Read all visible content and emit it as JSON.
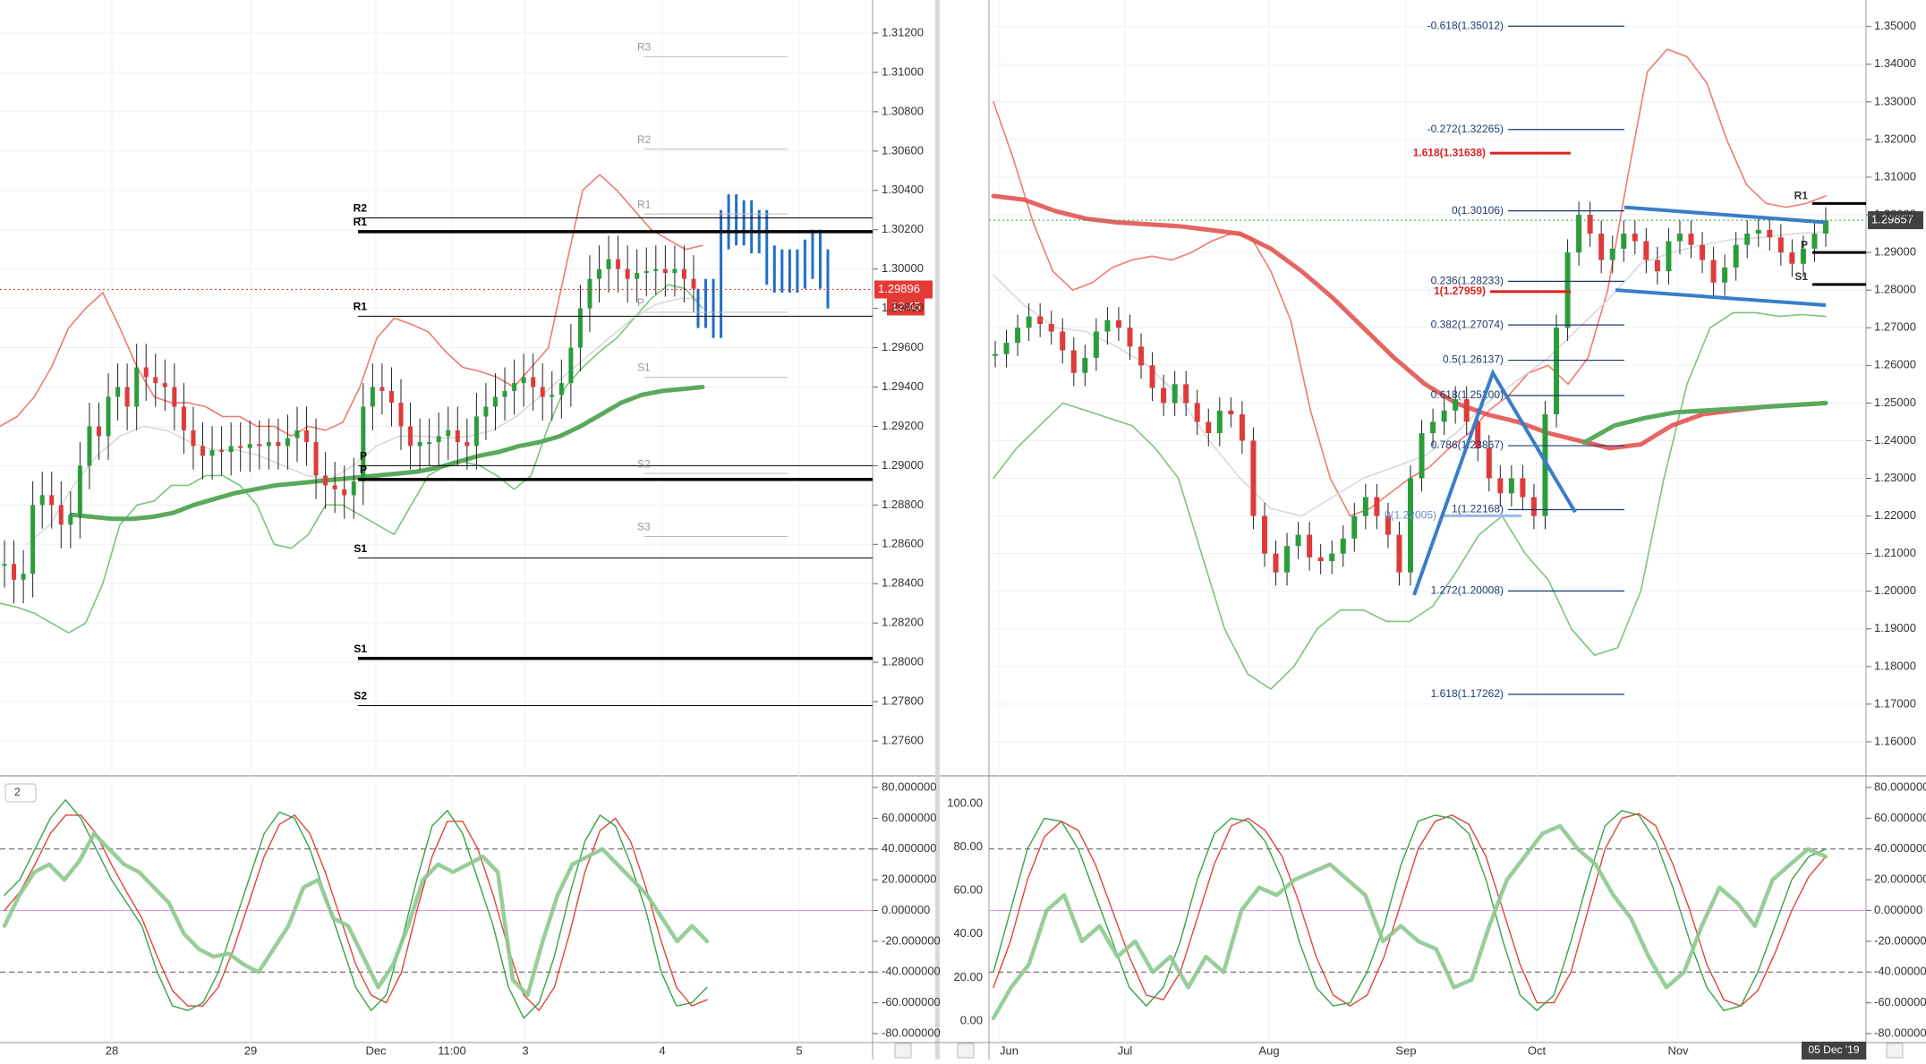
{
  "chart_data": [
    {
      "type": "line",
      "panel": "left-price",
      "y_ticks": [
        "1.31200",
        "1.31000",
        "1.30800",
        "1.30600",
        "1.30400",
        "1.30200",
        "1.30000",
        "1.29800",
        "1.29600",
        "1.29400",
        "1.29200",
        "1.29000",
        "1.28800",
        "1.28600",
        "1.28400",
        "1.28200",
        "1.28000",
        "1.27800",
        "1.27600"
      ],
      "ylim": [
        1.275,
        1.313
      ],
      "x_ticks": [
        "28",
        "29",
        "Dec",
        "11:00",
        "3",
        "4",
        "5"
      ],
      "price_label": "1.29896",
      "countdown_label": "12:45",
      "last_price": 1.29896,
      "pivot_levels": [
        {
          "label": "R3",
          "value": 1.3108,
          "style": "faint"
        },
        {
          "label": "R2",
          "value": 1.3061,
          "style": "faint"
        },
        {
          "label": "R1",
          "value": 1.3028,
          "style": "faint"
        },
        {
          "label": "R2",
          "value": 1.3026,
          "style": "thin"
        },
        {
          "label": "R1",
          "value": 1.3019,
          "style": "thick"
        },
        {
          "label": "P",
          "value": 1.2978,
          "style": "faint"
        },
        {
          "label": "R1",
          "value": 1.2976,
          "style": "thin"
        },
        {
          "label": "S1",
          "value": 1.2945,
          "style": "faint"
        },
        {
          "label": "P",
          "value": 1.29,
          "style": "thin"
        },
        {
          "label": "S2",
          "value": 1.2896,
          "style": "faint"
        },
        {
          "label": "P",
          "value": 1.2893,
          "style": "thick"
        },
        {
          "label": "S3",
          "value": 1.2864,
          "style": "faint"
        },
        {
          "label": "S1",
          "value": 1.2853,
          "style": "thin"
        },
        {
          "label": "S1",
          "value": 1.2802,
          "style": "thick"
        },
        {
          "label": "S2",
          "value": 1.2778,
          "style": "thin"
        }
      ],
      "close": [
        1.285,
        1.2842,
        1.2845,
        1.288,
        1.2885,
        1.288,
        1.287,
        1.2875,
        1.29,
        1.292,
        1.2915,
        1.2935,
        1.294,
        1.293,
        1.295,
        1.2945,
        1.2942,
        1.294,
        1.293,
        1.2918,
        1.291,
        1.2905,
        1.2908,
        1.2907,
        1.291,
        1.2909,
        1.2911,
        1.291,
        1.2912,
        1.291,
        1.2914,
        1.2918,
        1.2912,
        1.2895,
        1.289,
        1.2888,
        1.2885,
        1.2892,
        1.293,
        1.294,
        1.2938,
        1.2932,
        1.292,
        1.291,
        1.2912,
        1.2912,
        1.2915,
        1.2918,
        1.2912,
        1.291,
        1.2925,
        1.293,
        1.2935,
        1.2938,
        1.2942,
        1.2945,
        1.294,
        1.2935,
        1.2936,
        1.2942,
        1.296,
        1.298,
        1.2995,
        1.3,
        1.3005,
        1.3,
        1.2995,
        1.2998,
        1.2999,
        1.3,
        1.2998,
        1.3,
        1.2995,
        1.299
      ],
      "forecast_close": [
        1.298,
        1.2985,
        1.2975,
        1.302,
        1.3028,
        1.3022,
        1.3025,
        1.3018,
        1.302,
        1.3002,
        1.2998,
        1.3,
        1.2998,
        1.3,
        1.3005,
        1.301,
        1.3,
        1.299
      ],
      "bb_upper": [
        1.292,
        1.2925,
        1.2935,
        1.295,
        1.297,
        1.298,
        1.2988,
        1.297,
        1.295,
        1.2935,
        1.2932,
        1.2932,
        1.293,
        1.2925,
        1.2925,
        1.292,
        1.292,
        1.2915,
        1.292,
        1.2918,
        1.2922,
        1.294,
        1.2965,
        1.2975,
        1.2972,
        1.2968,
        1.2958,
        1.295,
        1.2948,
        1.2945,
        1.294,
        1.295,
        1.296,
        1.3,
        1.304,
        1.3048,
        1.304,
        1.303,
        1.302,
        1.3015,
        1.301,
        1.3012
      ],
      "bb_lower": [
        1.283,
        1.2828,
        1.2825,
        1.282,
        1.2815,
        1.282,
        1.284,
        1.287,
        1.288,
        1.2882,
        1.289,
        1.289,
        1.2895,
        1.2895,
        1.289,
        1.288,
        1.286,
        1.2858,
        1.2865,
        1.288,
        1.288,
        1.2875,
        1.287,
        1.2865,
        1.288,
        1.2895,
        1.29,
        1.2902,
        1.29,
        1.2895,
        1.2888,
        1.2895,
        1.292,
        1.294,
        1.295,
        1.2958,
        1.2965,
        1.2975,
        1.2985,
        1.2992,
        1.299,
        1.298
      ],
      "ma_slow": [
        1.2875,
        1.2874,
        1.2873,
        1.2873,
        1.2874,
        1.2876,
        1.288,
        1.2883,
        1.2886,
        1.2888,
        1.289,
        1.2891,
        1.2892,
        1.2893,
        1.2894,
        1.2895,
        1.2896,
        1.2897,
        1.2899,
        1.2902,
        1.2905,
        1.2907,
        1.291,
        1.2912,
        1.2915,
        1.292,
        1.2926,
        1.2932,
        1.2936,
        1.2938,
        1.2939,
        1.294
      ],
      "ma_mid": [
        1.286,
        1.287,
        1.289,
        1.2905,
        1.2915,
        1.292,
        1.2918,
        1.2912,
        1.2908,
        1.2908,
        1.2905,
        1.29,
        1.2895,
        1.2893,
        1.29,
        1.291,
        1.2915,
        1.2915,
        1.2914,
        1.2915,
        1.2918,
        1.2925,
        1.2935,
        1.2945,
        1.2955,
        1.2965,
        1.2975,
        1.2982,
        1.2985,
        1.2985
      ]
    },
    {
      "type": "line",
      "panel": "left-oscillator",
      "indicator_label": "2",
      "y_ticks": [
        "80.000000",
        "60.000000",
        "40.000000",
        "20.000000",
        "0.000000",
        "-20.000000",
        "-40.000000",
        "-60.000000",
        "-80.000000"
      ],
      "ylim": [
        -80,
        80
      ],
      "levels": [
        40,
        0,
        -40
      ],
      "fast": [
        10,
        20,
        40,
        60,
        72,
        60,
        40,
        20,
        5,
        -10,
        -40,
        -62,
        -65,
        -60,
        -40,
        -10,
        20,
        50,
        64,
        60,
        40,
        10,
        -20,
        -50,
        -65,
        -55,
        -20,
        20,
        55,
        65,
        50,
        20,
        -10,
        -50,
        -70,
        -60,
        -30,
        10,
        45,
        62,
        55,
        30,
        0,
        -40,
        -62,
        -60,
        -50
      ],
      "slow": [
        0,
        12,
        30,
        50,
        62,
        62,
        50,
        30,
        12,
        -5,
        -30,
        -52,
        -62,
        -62,
        -50,
        -25,
        5,
        35,
        56,
        62,
        50,
        25,
        -5,
        -35,
        -55,
        -60,
        -40,
        0,
        35,
        58,
        58,
        40,
        10,
        -25,
        -55,
        -65,
        -50,
        -15,
        25,
        52,
        60,
        45,
        15,
        -20,
        -50,
        -62,
        -58
      ],
      "thick": [
        -10,
        10,
        25,
        30,
        20,
        32,
        50,
        40,
        30,
        25,
        15,
        5,
        -15,
        -25,
        -30,
        -28,
        -35,
        -40,
        -25,
        -10,
        15,
        20,
        -5,
        -10,
        -30,
        -50,
        -35,
        -10,
        20,
        30,
        25,
        30,
        35,
        25,
        -45,
        -55,
        -20,
        10,
        30,
        35,
        40,
        30,
        20,
        10,
        -5,
        -20,
        -10,
        -20
      ]
    },
    {
      "type": "line",
      "panel": "right-price",
      "y_ticks": [
        "1.35000",
        "1.34000",
        "1.33000",
        "1.32000",
        "1.31000",
        "1.30000",
        "1.29000",
        "1.28000",
        "1.27000",
        "1.26000",
        "1.25000",
        "1.24000",
        "1.23000",
        "1.22000",
        "1.21000",
        "1.20000",
        "1.19000",
        "1.18000",
        "1.17000",
        "1.16000"
      ],
      "ylim": [
        1.155,
        1.3535
      ],
      "x_ticks": [
        "Jun",
        "Jul",
        "Aug",
        "Sep",
        "Oct",
        "Nov"
      ],
      "date_label": "05 Dec '19",
      "price_label": "1.29857",
      "last_price": 1.29857,
      "fibonacci": [
        {
          "label": "-0.618(1.35012)",
          "value": 1.35012
        },
        {
          "label": "-0.272(1.32265)",
          "value": 1.32265
        },
        {
          "label": "0(1.30106)",
          "value": 1.30106
        },
        {
          "label": "0.236(1.28233)",
          "value": 1.28233
        },
        {
          "label": "0.382(1.27074)",
          "value": 1.27074
        },
        {
          "label": "0.5(1.26137)",
          "value": 1.26137
        },
        {
          "label": "0.618(1.25200)",
          "value": 1.252
        },
        {
          "label": "0.786(1.23867)",
          "value": 1.23867
        },
        {
          "label": "1(1.22168)",
          "value": 1.22168
        },
        {
          "label": "1.272(1.20008)",
          "value": 1.20008
        },
        {
          "label": "1.618(1.17262)",
          "value": 1.17262
        }
      ],
      "red_levels": [
        {
          "label": "1.618(1.31638)",
          "value": 1.31638
        },
        {
          "label": "1(1.27959)",
          "value": 1.27959
        }
      ],
      "abc_label": "0(1.22005)",
      "abc_value": 1.22005,
      "pivot_levels": [
        {
          "label": "R1",
          "value": 1.303
        },
        {
          "label": "P",
          "value": 1.29
        },
        {
          "label": "S1",
          "value": 1.2815
        }
      ],
      "close": [
        1.263,
        1.266,
        1.27,
        1.273,
        1.271,
        1.269,
        1.264,
        1.258,
        1.262,
        1.269,
        1.272,
        1.27,
        1.265,
        1.26,
        1.254,
        1.25,
        1.255,
        1.25,
        1.245,
        1.242,
        1.248,
        1.247,
        1.24,
        1.22,
        1.21,
        1.205,
        1.212,
        1.215,
        1.209,
        1.208,
        1.21,
        1.214,
        1.22,
        1.225,
        1.22,
        1.215,
        1.205,
        1.23,
        1.242,
        1.245,
        1.248,
        1.251,
        1.245,
        1.238,
        1.23,
        1.226,
        1.23,
        1.225,
        1.22,
        1.247,
        1.27,
        1.29,
        1.3,
        1.295,
        1.288,
        1.291,
        1.295,
        1.293,
        1.288,
        1.285,
        1.293,
        1.295,
        1.292,
        1.288,
        1.282,
        1.286,
        1.292,
        1.295,
        1.296,
        1.294,
        1.29,
        1.287,
        1.291,
        1.295,
        1.2985
      ],
      "bb_upper": [
        1.33,
        1.315,
        1.298,
        1.285,
        1.28,
        1.282,
        1.286,
        1.288,
        1.289,
        1.288,
        1.29,
        1.293,
        1.295,
        1.294,
        1.285,
        1.272,
        1.248,
        1.23,
        1.22,
        1.222,
        1.226,
        1.23,
        1.233,
        1.238,
        1.242,
        1.248,
        1.252,
        1.258,
        1.26,
        1.255,
        1.262,
        1.28,
        1.31,
        1.338,
        1.344,
        1.342,
        1.335,
        1.32,
        1.308,
        1.303,
        1.302,
        1.303,
        1.305
      ],
      "bb_lower": [
        1.23,
        1.238,
        1.244,
        1.25,
        1.248,
        1.246,
        1.244,
        1.238,
        1.23,
        1.21,
        1.19,
        1.178,
        1.174,
        1.18,
        1.19,
        1.195,
        1.195,
        1.192,
        1.192,
        1.196,
        1.205,
        1.215,
        1.22,
        1.21,
        1.203,
        1.19,
        1.183,
        1.185,
        1.2,
        1.23,
        1.255,
        1.27,
        1.274,
        1.274,
        1.273,
        1.2735,
        1.273
      ],
      "ma_slow": [
        1.305,
        1.304,
        1.301,
        1.299,
        1.298,
        1.2975,
        1.297,
        1.296,
        1.295,
        1.291,
        1.285,
        1.278,
        1.27,
        1.262,
        1.255,
        1.25,
        1.247,
        1.245,
        1.242,
        1.24,
        1.238,
        1.239,
        1.244,
        1.247,
        1.248,
        1.249,
        1.2495,
        1.25
      ],
      "ma_mid": [
        1.284,
        1.276,
        1.27,
        1.269,
        1.265,
        1.26,
        1.252,
        1.24,
        1.23,
        1.222,
        1.22,
        1.225,
        1.23,
        1.233,
        1.236,
        1.242,
        1.25,
        1.256,
        1.262,
        1.27,
        1.278,
        1.287,
        1.29,
        1.292,
        1.2935,
        1.294,
        1.295,
        1.2955
      ],
      "wedge_top": [
        1.302,
        1.298
      ],
      "wedge_bottom": [
        1.28,
        1.276
      ],
      "zigzag": [
        1.199,
        1.258,
        1.221
      ]
    },
    {
      "type": "line",
      "panel": "right-oscillator",
      "left_y_ticks": [
        "100.00",
        "80.00",
        "60.00",
        "40.00",
        "20.00",
        "0.00"
      ],
      "right_y_ticks": [
        "80.000000",
        "60.000000",
        "40.000000",
        "20.000000",
        "0.000000",
        "-20.000000",
        "-40.000000",
        "-60.000000",
        "-80.000000"
      ],
      "ylim": [
        -80,
        80
      ],
      "levels": [
        40,
        0,
        -40
      ],
      "fast": [
        -40,
        0,
        40,
        60,
        58,
        40,
        10,
        -20,
        -50,
        -62,
        -50,
        -20,
        20,
        50,
        60,
        58,
        45,
        20,
        -20,
        -50,
        -62,
        -60,
        -40,
        -10,
        30,
        58,
        62,
        60,
        50,
        20,
        -20,
        -55,
        -65,
        -55,
        -20,
        20,
        55,
        65,
        62,
        45,
        15,
        -20,
        -50,
        -65,
        -62,
        -40,
        -10,
        20,
        35,
        40
      ],
      "slow": [
        -50,
        -20,
        20,
        48,
        58,
        52,
        30,
        0,
        -30,
        -55,
        -58,
        -40,
        -5,
        30,
        55,
        60,
        52,
        35,
        5,
        -30,
        -55,
        -62,
        -55,
        -30,
        5,
        40,
        58,
        62,
        56,
        35,
        0,
        -35,
        -60,
        -60,
        -40,
        0,
        40,
        60,
        63,
        55,
        30,
        0,
        -35,
        -58,
        -62,
        -52,
        -28,
        0,
        22,
        35
      ],
      "thick": [
        -70,
        -50,
        -35,
        0,
        10,
        -20,
        -10,
        -30,
        -20,
        -40,
        -30,
        -50,
        -30,
        -40,
        0,
        15,
        10,
        20,
        25,
        30,
        20,
        10,
        -20,
        -10,
        -20,
        -25,
        -50,
        -45,
        -10,
        20,
        35,
        50,
        55,
        40,
        30,
        10,
        -5,
        -30,
        -50,
        -40,
        -10,
        15,
        5,
        -10,
        20,
        30,
        40,
        35
      ]
    }
  ]
}
